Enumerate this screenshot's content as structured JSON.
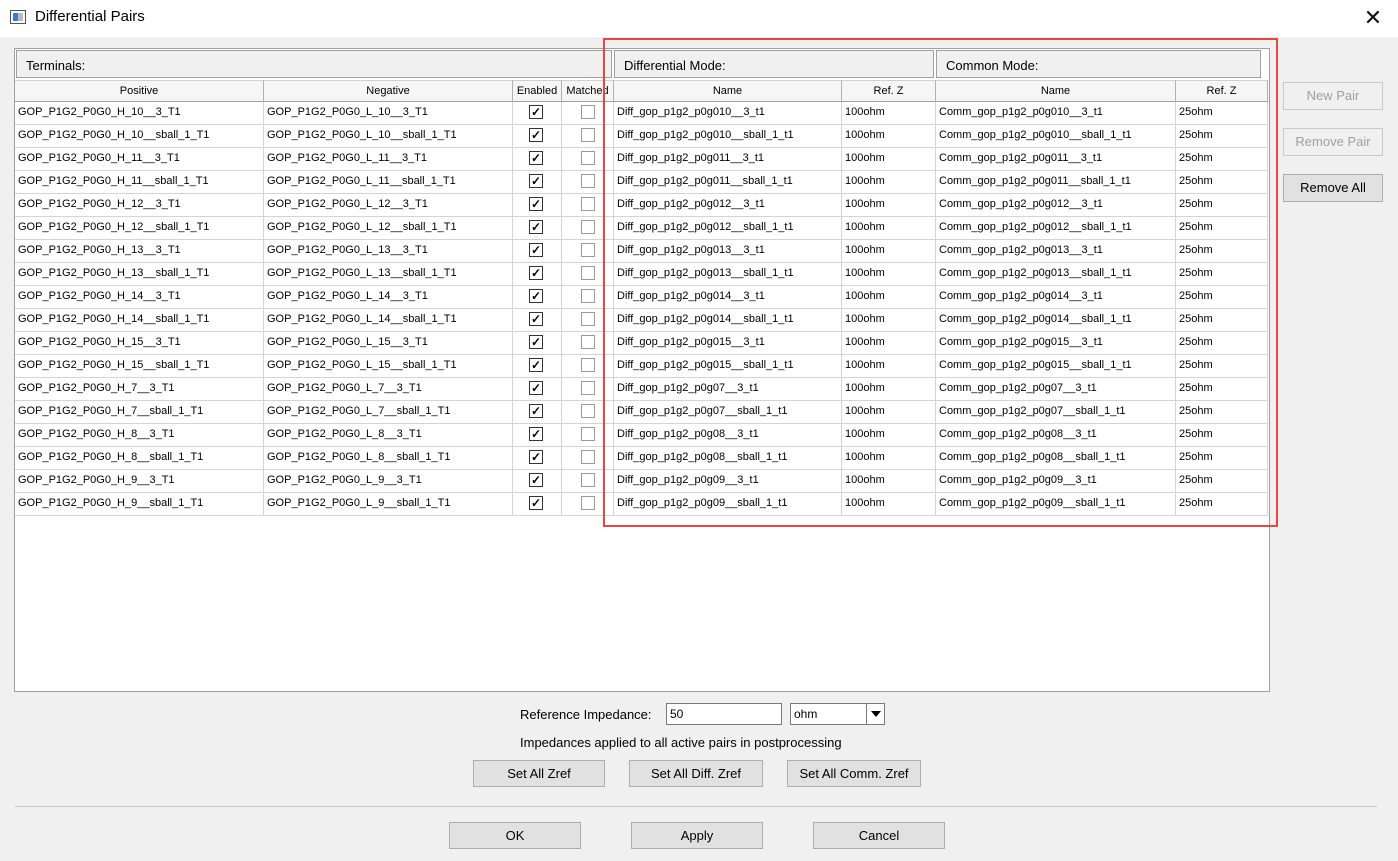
{
  "window": {
    "title": "Differential Pairs",
    "close_glyph": "✕"
  },
  "groups": {
    "terminals": "Terminals:",
    "differential_mode": "Differential Mode:",
    "common_mode": "Common Mode:"
  },
  "columns": {
    "positive": "Positive",
    "negative": "Negative",
    "enabled": "Enabled",
    "matched": "Matched",
    "diff_name": "Name",
    "diff_refz": "Ref. Z",
    "comm_name": "Name",
    "comm_refz": "Ref. Z"
  },
  "rows": [
    {
      "positive": "GOP_P1G2_P0G0_H_10__3_T1",
      "negative": "GOP_P1G2_P0G0_L_10__3_T1",
      "enabled": true,
      "matched": false,
      "diff_name": "Diff_gop_p1g2_p0g010__3_t1",
      "diff_refz": "100ohm",
      "comm_name": "Comm_gop_p1g2_p0g010__3_t1",
      "comm_refz": "25ohm"
    },
    {
      "positive": "GOP_P1G2_P0G0_H_10__sball_1_T1",
      "negative": "GOP_P1G2_P0G0_L_10__sball_1_T1",
      "enabled": true,
      "matched": false,
      "diff_name": "Diff_gop_p1g2_p0g010__sball_1_t1",
      "diff_refz": "100ohm",
      "comm_name": "Comm_gop_p1g2_p0g010__sball_1_t1",
      "comm_refz": "25ohm"
    },
    {
      "positive": "GOP_P1G2_P0G0_H_11__3_T1",
      "negative": "GOP_P1G2_P0G0_L_11__3_T1",
      "enabled": true,
      "matched": false,
      "diff_name": "Diff_gop_p1g2_p0g011__3_t1",
      "diff_refz": "100ohm",
      "comm_name": "Comm_gop_p1g2_p0g011__3_t1",
      "comm_refz": "25ohm"
    },
    {
      "positive": "GOP_P1G2_P0G0_H_11__sball_1_T1",
      "negative": "GOP_P1G2_P0G0_L_11__sball_1_T1",
      "enabled": true,
      "matched": false,
      "diff_name": "Diff_gop_p1g2_p0g011__sball_1_t1",
      "diff_refz": "100ohm",
      "comm_name": "Comm_gop_p1g2_p0g011__sball_1_t1",
      "comm_refz": "25ohm"
    },
    {
      "positive": "GOP_P1G2_P0G0_H_12__3_T1",
      "negative": "GOP_P1G2_P0G0_L_12__3_T1",
      "enabled": true,
      "matched": false,
      "diff_name": "Diff_gop_p1g2_p0g012__3_t1",
      "diff_refz": "100ohm",
      "comm_name": "Comm_gop_p1g2_p0g012__3_t1",
      "comm_refz": "25ohm"
    },
    {
      "positive": "GOP_P1G2_P0G0_H_12__sball_1_T1",
      "negative": "GOP_P1G2_P0G0_L_12__sball_1_T1",
      "enabled": true,
      "matched": false,
      "diff_name": "Diff_gop_p1g2_p0g012__sball_1_t1",
      "diff_refz": "100ohm",
      "comm_name": "Comm_gop_p1g2_p0g012__sball_1_t1",
      "comm_refz": "25ohm"
    },
    {
      "positive": "GOP_P1G2_P0G0_H_13__3_T1",
      "negative": "GOP_P1G2_P0G0_L_13__3_T1",
      "enabled": true,
      "matched": false,
      "diff_name": "Diff_gop_p1g2_p0g013__3_t1",
      "diff_refz": "100ohm",
      "comm_name": "Comm_gop_p1g2_p0g013__3_t1",
      "comm_refz": "25ohm"
    },
    {
      "positive": "GOP_P1G2_P0G0_H_13__sball_1_T1",
      "negative": "GOP_P1G2_P0G0_L_13__sball_1_T1",
      "enabled": true,
      "matched": false,
      "diff_name": "Diff_gop_p1g2_p0g013__sball_1_t1",
      "diff_refz": "100ohm",
      "comm_name": "Comm_gop_p1g2_p0g013__sball_1_t1",
      "comm_refz": "25ohm"
    },
    {
      "positive": "GOP_P1G2_P0G0_H_14__3_T1",
      "negative": "GOP_P1G2_P0G0_L_14__3_T1",
      "enabled": true,
      "matched": false,
      "diff_name": "Diff_gop_p1g2_p0g014__3_t1",
      "diff_refz": "100ohm",
      "comm_name": "Comm_gop_p1g2_p0g014__3_t1",
      "comm_refz": "25ohm"
    },
    {
      "positive": "GOP_P1G2_P0G0_H_14__sball_1_T1",
      "negative": "GOP_P1G2_P0G0_L_14__sball_1_T1",
      "enabled": true,
      "matched": false,
      "diff_name": "Diff_gop_p1g2_p0g014__sball_1_t1",
      "diff_refz": "100ohm",
      "comm_name": "Comm_gop_p1g2_p0g014__sball_1_t1",
      "comm_refz": "25ohm"
    },
    {
      "positive": "GOP_P1G2_P0G0_H_15__3_T1",
      "negative": "GOP_P1G2_P0G0_L_15__3_T1",
      "enabled": true,
      "matched": false,
      "diff_name": "Diff_gop_p1g2_p0g015__3_t1",
      "diff_refz": "100ohm",
      "comm_name": "Comm_gop_p1g2_p0g015__3_t1",
      "comm_refz": "25ohm"
    },
    {
      "positive": "GOP_P1G2_P0G0_H_15__sball_1_T1",
      "negative": "GOP_P1G2_P0G0_L_15__sball_1_T1",
      "enabled": true,
      "matched": false,
      "diff_name": "Diff_gop_p1g2_p0g015__sball_1_t1",
      "diff_refz": "100ohm",
      "comm_name": "Comm_gop_p1g2_p0g015__sball_1_t1",
      "comm_refz": "25ohm"
    },
    {
      "positive": "GOP_P1G2_P0G0_H_7__3_T1",
      "negative": "GOP_P1G2_P0G0_L_7__3_T1",
      "enabled": true,
      "matched": false,
      "diff_name": "Diff_gop_p1g2_p0g07__3_t1",
      "diff_refz": "100ohm",
      "comm_name": "Comm_gop_p1g2_p0g07__3_t1",
      "comm_refz": "25ohm"
    },
    {
      "positive": "GOP_P1G2_P0G0_H_7__sball_1_T1",
      "negative": "GOP_P1G2_P0G0_L_7__sball_1_T1",
      "enabled": true,
      "matched": false,
      "diff_name": "Diff_gop_p1g2_p0g07__sball_1_t1",
      "diff_refz": "100ohm",
      "comm_name": "Comm_gop_p1g2_p0g07__sball_1_t1",
      "comm_refz": "25ohm"
    },
    {
      "positive": "GOP_P1G2_P0G0_H_8__3_T1",
      "negative": "GOP_P1G2_P0G0_L_8__3_T1",
      "enabled": true,
      "matched": false,
      "diff_name": "Diff_gop_p1g2_p0g08__3_t1",
      "diff_refz": "100ohm",
      "comm_name": "Comm_gop_p1g2_p0g08__3_t1",
      "comm_refz": "25ohm"
    },
    {
      "positive": "GOP_P1G2_P0G0_H_8__sball_1_T1",
      "negative": "GOP_P1G2_P0G0_L_8__sball_1_T1",
      "enabled": true,
      "matched": false,
      "diff_name": "Diff_gop_p1g2_p0g08__sball_1_t1",
      "diff_refz": "100ohm",
      "comm_name": "Comm_gop_p1g2_p0g08__sball_1_t1",
      "comm_refz": "25ohm"
    },
    {
      "positive": "GOP_P1G2_P0G0_H_9__3_T1",
      "negative": "GOP_P1G2_P0G0_L_9__3_T1",
      "enabled": true,
      "matched": false,
      "diff_name": "Diff_gop_p1g2_p0g09__3_t1",
      "diff_refz": "100ohm",
      "comm_name": "Comm_gop_p1g2_p0g09__3_t1",
      "comm_refz": "25ohm"
    },
    {
      "positive": "GOP_P1G2_P0G0_H_9__sball_1_T1",
      "negative": "GOP_P1G2_P0G0_L_9__sball_1_T1",
      "enabled": true,
      "matched": false,
      "diff_name": "Diff_gop_p1g2_p0g09__sball_1_t1",
      "diff_refz": "100ohm",
      "comm_name": "Comm_gop_p1g2_p0g09__sball_1_t1",
      "comm_refz": "25ohm"
    }
  ],
  "side_buttons": {
    "new_pair": "New Pair",
    "remove_pair": "Remove Pair",
    "remove_all": "Remove All"
  },
  "impedance": {
    "label": "Reference Impedance:",
    "value": "50",
    "unit": "ohm",
    "note": "Impedances applied to all active pairs in postprocessing"
  },
  "zref_buttons": {
    "set_all": "Set All Zref",
    "set_all_diff": "Set All Diff. Zref",
    "set_all_comm": "Set All Comm. Zref"
  },
  "dialog_buttons": {
    "ok": "OK",
    "apply": "Apply",
    "cancel": "Cancel"
  },
  "colors": {
    "highlight_box": "#e84545",
    "window_bg": "#f0f0f0"
  }
}
